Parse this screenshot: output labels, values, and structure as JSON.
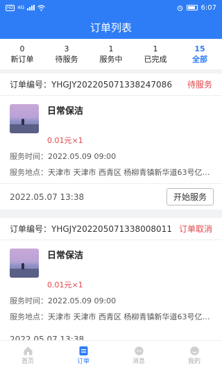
{
  "status_bar": {
    "network": "HD",
    "signal": "4G",
    "time": "6:07"
  },
  "header": {
    "title": "订单列表"
  },
  "tabs": [
    {
      "count": "0",
      "label": "新订单",
      "active": false
    },
    {
      "count": "3",
      "label": "待服务",
      "active": false
    },
    {
      "count": "1",
      "label": "服务中",
      "active": false
    },
    {
      "count": "1",
      "label": "已完成",
      "active": false
    },
    {
      "count": "15",
      "label": "全部",
      "active": true
    }
  ],
  "orders": [
    {
      "order_no": "订单编号：YHGJY202205071338247086",
      "status": "待服务",
      "product_name": "日常保洁",
      "price": "0.01元×1",
      "service_time_label": "服务时间：",
      "service_time": "2022.05.09 09:00",
      "service_place_label": "服务地点：",
      "service_place": "天津市 天津市 西青区 杨柳青镇新华道63号亿慧...",
      "created": "2022.05.07 13:38",
      "action": "开始服务"
    },
    {
      "order_no": "订单编号：YHGJY202205071338008011",
      "status": "订单取消",
      "product_name": "日常保洁",
      "price": "0.01元×1",
      "service_time_label": "服务时间：",
      "service_time": "2022.05.09 09:00",
      "service_place_label": "服务地点：",
      "service_place": "天津市 天津市 西青区 杨柳青镇新华道63号亿慧...",
      "created": "2022.05.07 13:38"
    }
  ],
  "bottom_nav": [
    {
      "label": "首页",
      "icon": "home-icon",
      "active": false
    },
    {
      "label": "订单",
      "icon": "order-icon",
      "active": true
    },
    {
      "label": "消息",
      "icon": "message-icon",
      "active": false
    },
    {
      "label": "我的",
      "icon": "profile-icon",
      "active": false
    }
  ],
  "colors": {
    "primary": "#2f7df6",
    "status_red": "#e0454a"
  }
}
